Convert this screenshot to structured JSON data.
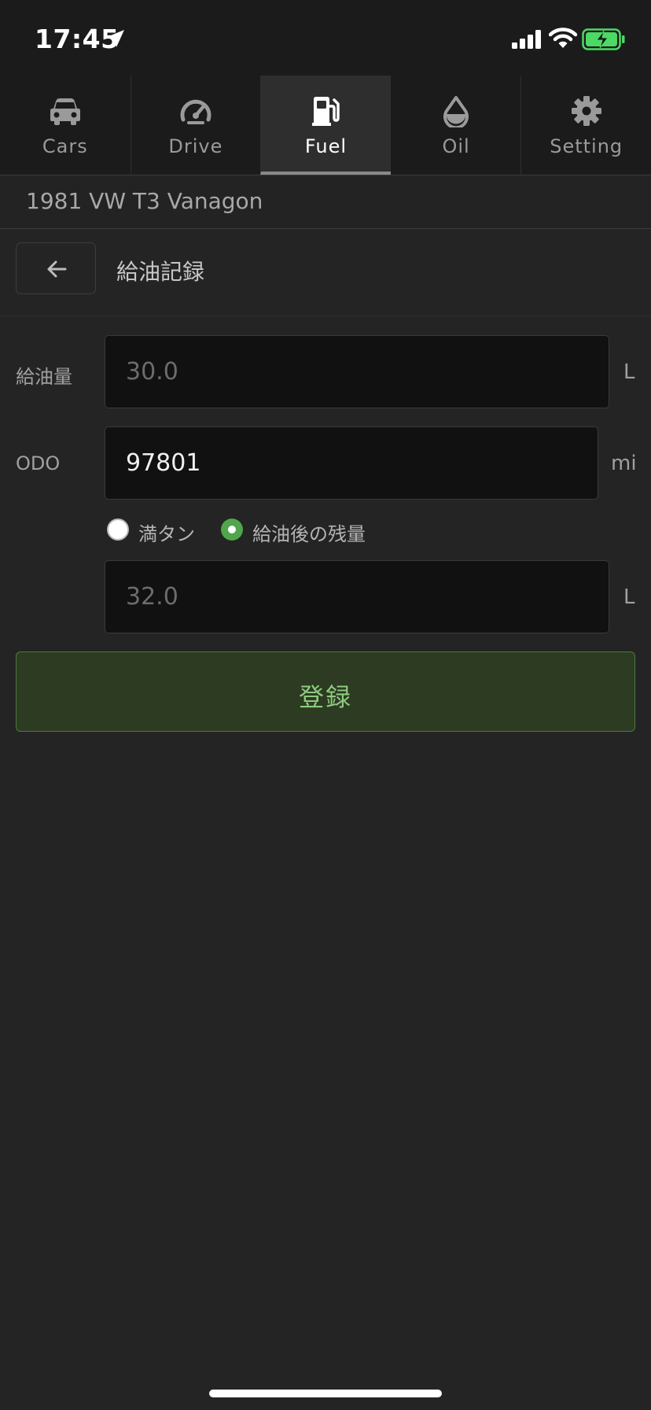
{
  "status_bar": {
    "time": "17:45",
    "icons": [
      "location-arrow-icon",
      "signal-icon",
      "wifi-icon",
      "battery-charging-icon"
    ]
  },
  "tabs": [
    {
      "label": "Cars",
      "icon": "car-icon",
      "active": false
    },
    {
      "label": "Drive",
      "icon": "speedometer-icon",
      "active": false
    },
    {
      "label": "Fuel",
      "icon": "fuel-pump-icon",
      "active": true
    },
    {
      "label": "Oil",
      "icon": "oil-drop-icon",
      "active": false
    },
    {
      "label": "Setting",
      "icon": "gear-icon",
      "active": false
    }
  ],
  "car": {
    "title": "1981 VW T3 Vanagon"
  },
  "page": {
    "title": "給油記録",
    "back_icon": "arrow-left-icon"
  },
  "form": {
    "fuel_amount": {
      "label": "給油量",
      "placeholder": "30.0",
      "unit": "L"
    },
    "odo": {
      "label": "ODO",
      "value": "97801",
      "unit": "mi"
    },
    "radio_options": [
      {
        "label": "満タン",
        "selected": false
      },
      {
        "label": "給油後の残量",
        "selected": true
      }
    ],
    "remaining": {
      "placeholder": "32.0",
      "unit": "L"
    },
    "submit_label": "登録"
  },
  "colors": {
    "background": "#242424",
    "accent_green": "#4fa64b",
    "submit_bg": "#2c3b22",
    "submit_text": "#8fca7f"
  }
}
